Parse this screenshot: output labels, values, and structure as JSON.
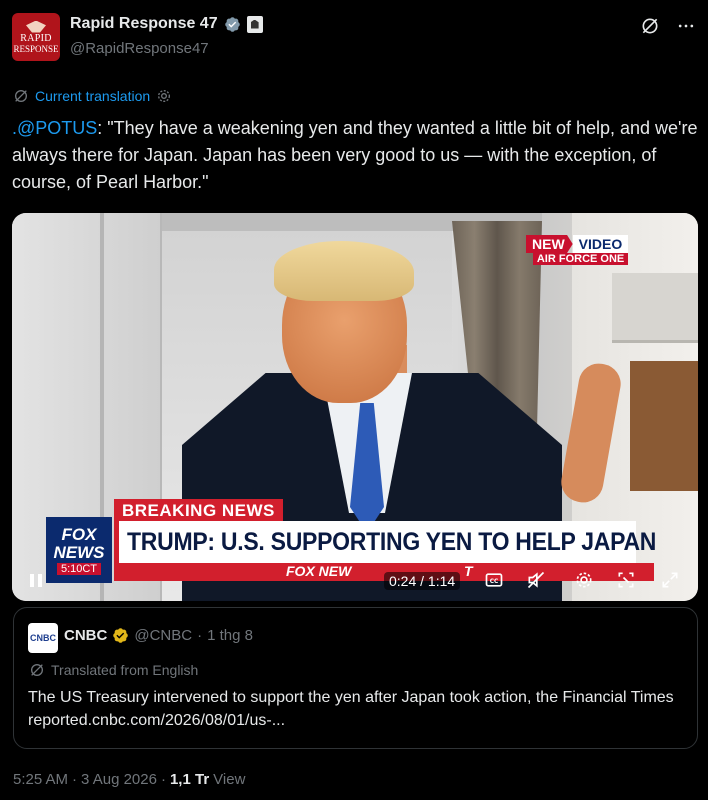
{
  "author": {
    "display_name": "Rapid Response 47",
    "handle": "@RapidResponse47",
    "avatar_text_1": "RAPID",
    "avatar_text_2": "RESPONSE"
  },
  "translation": {
    "label": "Current translation"
  },
  "tweet": {
    "mention": ".@POTUS",
    "text": ": \"They have a weakening yen and they wanted a little bit of help, and we're always there for Japan. Japan has been very good to us — with the exception, of course, of Pearl Harbor.\""
  },
  "video": {
    "badge_new": "NEW",
    "badge_video": "VIDEO",
    "badge_location": "AIR FORCE ONE",
    "breaking": "BREAKING NEWS",
    "headline": "TRUMP: U.S. SUPPORTING YEN TO HELP JAPAN",
    "network_line1": "FOX",
    "network_line2": "NEWS",
    "network_time": "5:10CT",
    "ticker": "FOX NEW",
    "ticker_tail": "T",
    "time_display": "0:24 / 1:14",
    "progress": 0.324
  },
  "quote": {
    "avatar_text": "CNBC",
    "name": "CNBC",
    "handle": "@CNBC",
    "separator": "·",
    "date": "1 thg 8",
    "translated_label": "Translated from English",
    "text": "The US Treasury intervened to support the yen after Japan took action, the Financial Times reported.cnbc.com/2026/08/01/us-..."
  },
  "footer": {
    "time": "5:25 AM",
    "dot1": "·",
    "date": "3 Aug 2026",
    "dot2": "·",
    "views_count": "1,1 Tr",
    "views_label": "View"
  },
  "colors": {
    "background": "#000000",
    "text": "#e7e9ea",
    "muted": "#71767b",
    "link": "#1d9bf0",
    "border": "#2f3336",
    "fox_red": "#d21f2d",
    "fox_blue": "#0b2a6e"
  }
}
